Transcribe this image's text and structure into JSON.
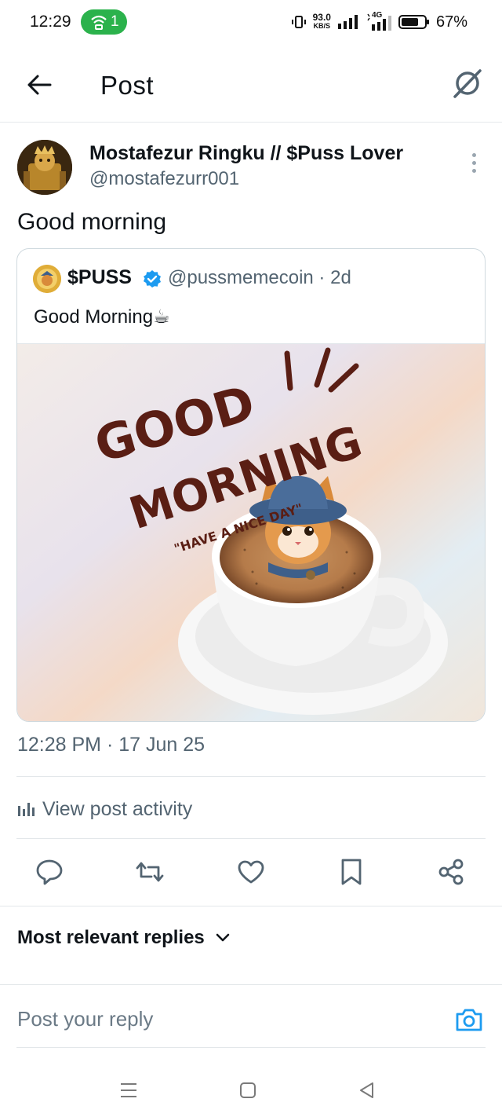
{
  "status_bar": {
    "time": "12:29",
    "hotspot_count": "1",
    "net_speed_value": "93.0",
    "net_speed_unit": "KB/S",
    "network_type": "4G",
    "battery": "67%"
  },
  "header": {
    "title": "Post"
  },
  "post": {
    "author_name": "Mostafezur Ringku // $Puss Lover",
    "author_handle": "@mostafezurr001",
    "text": "Good morning",
    "timestamp": "12:28 PM · 17 Jun 25",
    "activity_label": "View post activity"
  },
  "quoted_post": {
    "name": "$PUSS",
    "handle_time": "@pussmemecoin · 2d",
    "text": "Good Morning☕",
    "image": {
      "line1": "GOOD",
      "line2": "MORNING",
      "tagline": "\"HAVE A NICE DAY\""
    }
  },
  "replies": {
    "sort_label": "Most relevant replies",
    "reply_placeholder": "Post your reply"
  },
  "colors": {
    "accent": "#1d9bf0",
    "text_primary": "#0f1419",
    "text_secondary": "#536471",
    "status_green": "#2bb24c",
    "image_lettering": "#5a1e14"
  },
  "icons": {
    "back": "arrow-left-icon",
    "grok": "grok-icon",
    "reply": "reply-icon",
    "repost": "repost-icon",
    "like": "heart-icon",
    "bookmark": "bookmark-icon",
    "share": "share-icon",
    "camera": "camera-icon"
  }
}
